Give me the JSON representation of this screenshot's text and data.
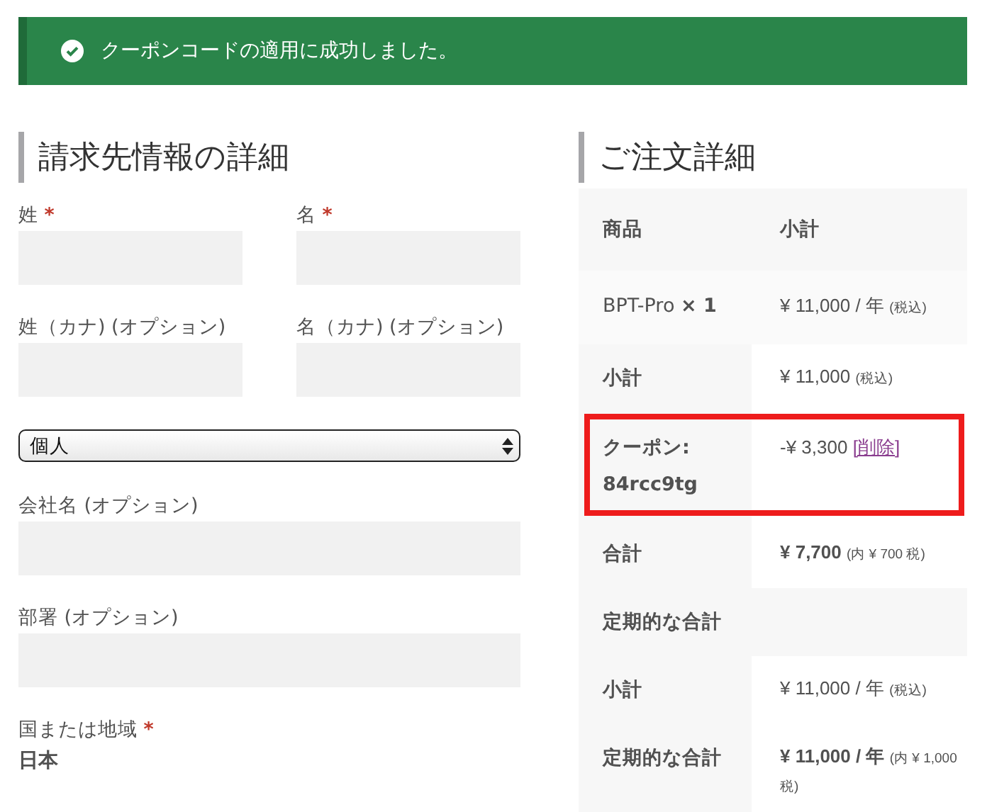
{
  "notice": {
    "message": "クーポンコードの適用に成功しました。"
  },
  "billing": {
    "title": "請求先情報の詳細",
    "fields": [
      {
        "kind": "input",
        "label": "姓",
        "required_mark": "*",
        "half": true
      },
      {
        "kind": "input",
        "label": "名",
        "required_mark": "*",
        "half": true
      },
      {
        "kind": "input",
        "label": "姓（カナ) (オプション)",
        "half": true
      },
      {
        "kind": "input",
        "label": "名（カナ) (オプション)",
        "half": true
      },
      {
        "kind": "select",
        "value": "個人",
        "half": false
      },
      {
        "kind": "input",
        "label": "会社名 (オプション)",
        "half": false
      },
      {
        "kind": "input",
        "label": "部署 (オプション)",
        "half": false
      },
      {
        "kind": "static",
        "label": "国または地域",
        "required_mark": "*",
        "value": "日本",
        "half": false
      }
    ]
  },
  "order": {
    "title": "ご注文詳細",
    "columns": [
      "商品",
      "小計"
    ],
    "rows": [
      {
        "kind": "item",
        "label": "BPT-Pro",
        "qty": "× 1",
        "value": "¥ 11,000 / 年",
        "note": "(税込)"
      },
      {
        "kind": "total",
        "label": "小計",
        "value": "¥ 11,000",
        "note": "(税込)",
        "bold": false
      },
      {
        "kind": "coupon",
        "label": "クーポン: 84rcc9tg",
        "value": "-¥ 3,300",
        "link": "[削除]",
        "highlighted": true
      },
      {
        "kind": "total",
        "label": "合計",
        "value": "¥ 7,700",
        "note": "(内 ¥ 700 税)",
        "bold": true
      },
      {
        "kind": "section",
        "label": "定期的な合計"
      },
      {
        "kind": "total",
        "label": "小計",
        "value": "¥ 11,000 / 年",
        "note": "(税込)",
        "bold": false
      },
      {
        "kind": "total",
        "label": "定期的な合計",
        "value": "¥ 11,000 / 年",
        "note": "(内 ¥ 1,000 税)",
        "bold": true
      }
    ]
  }
}
